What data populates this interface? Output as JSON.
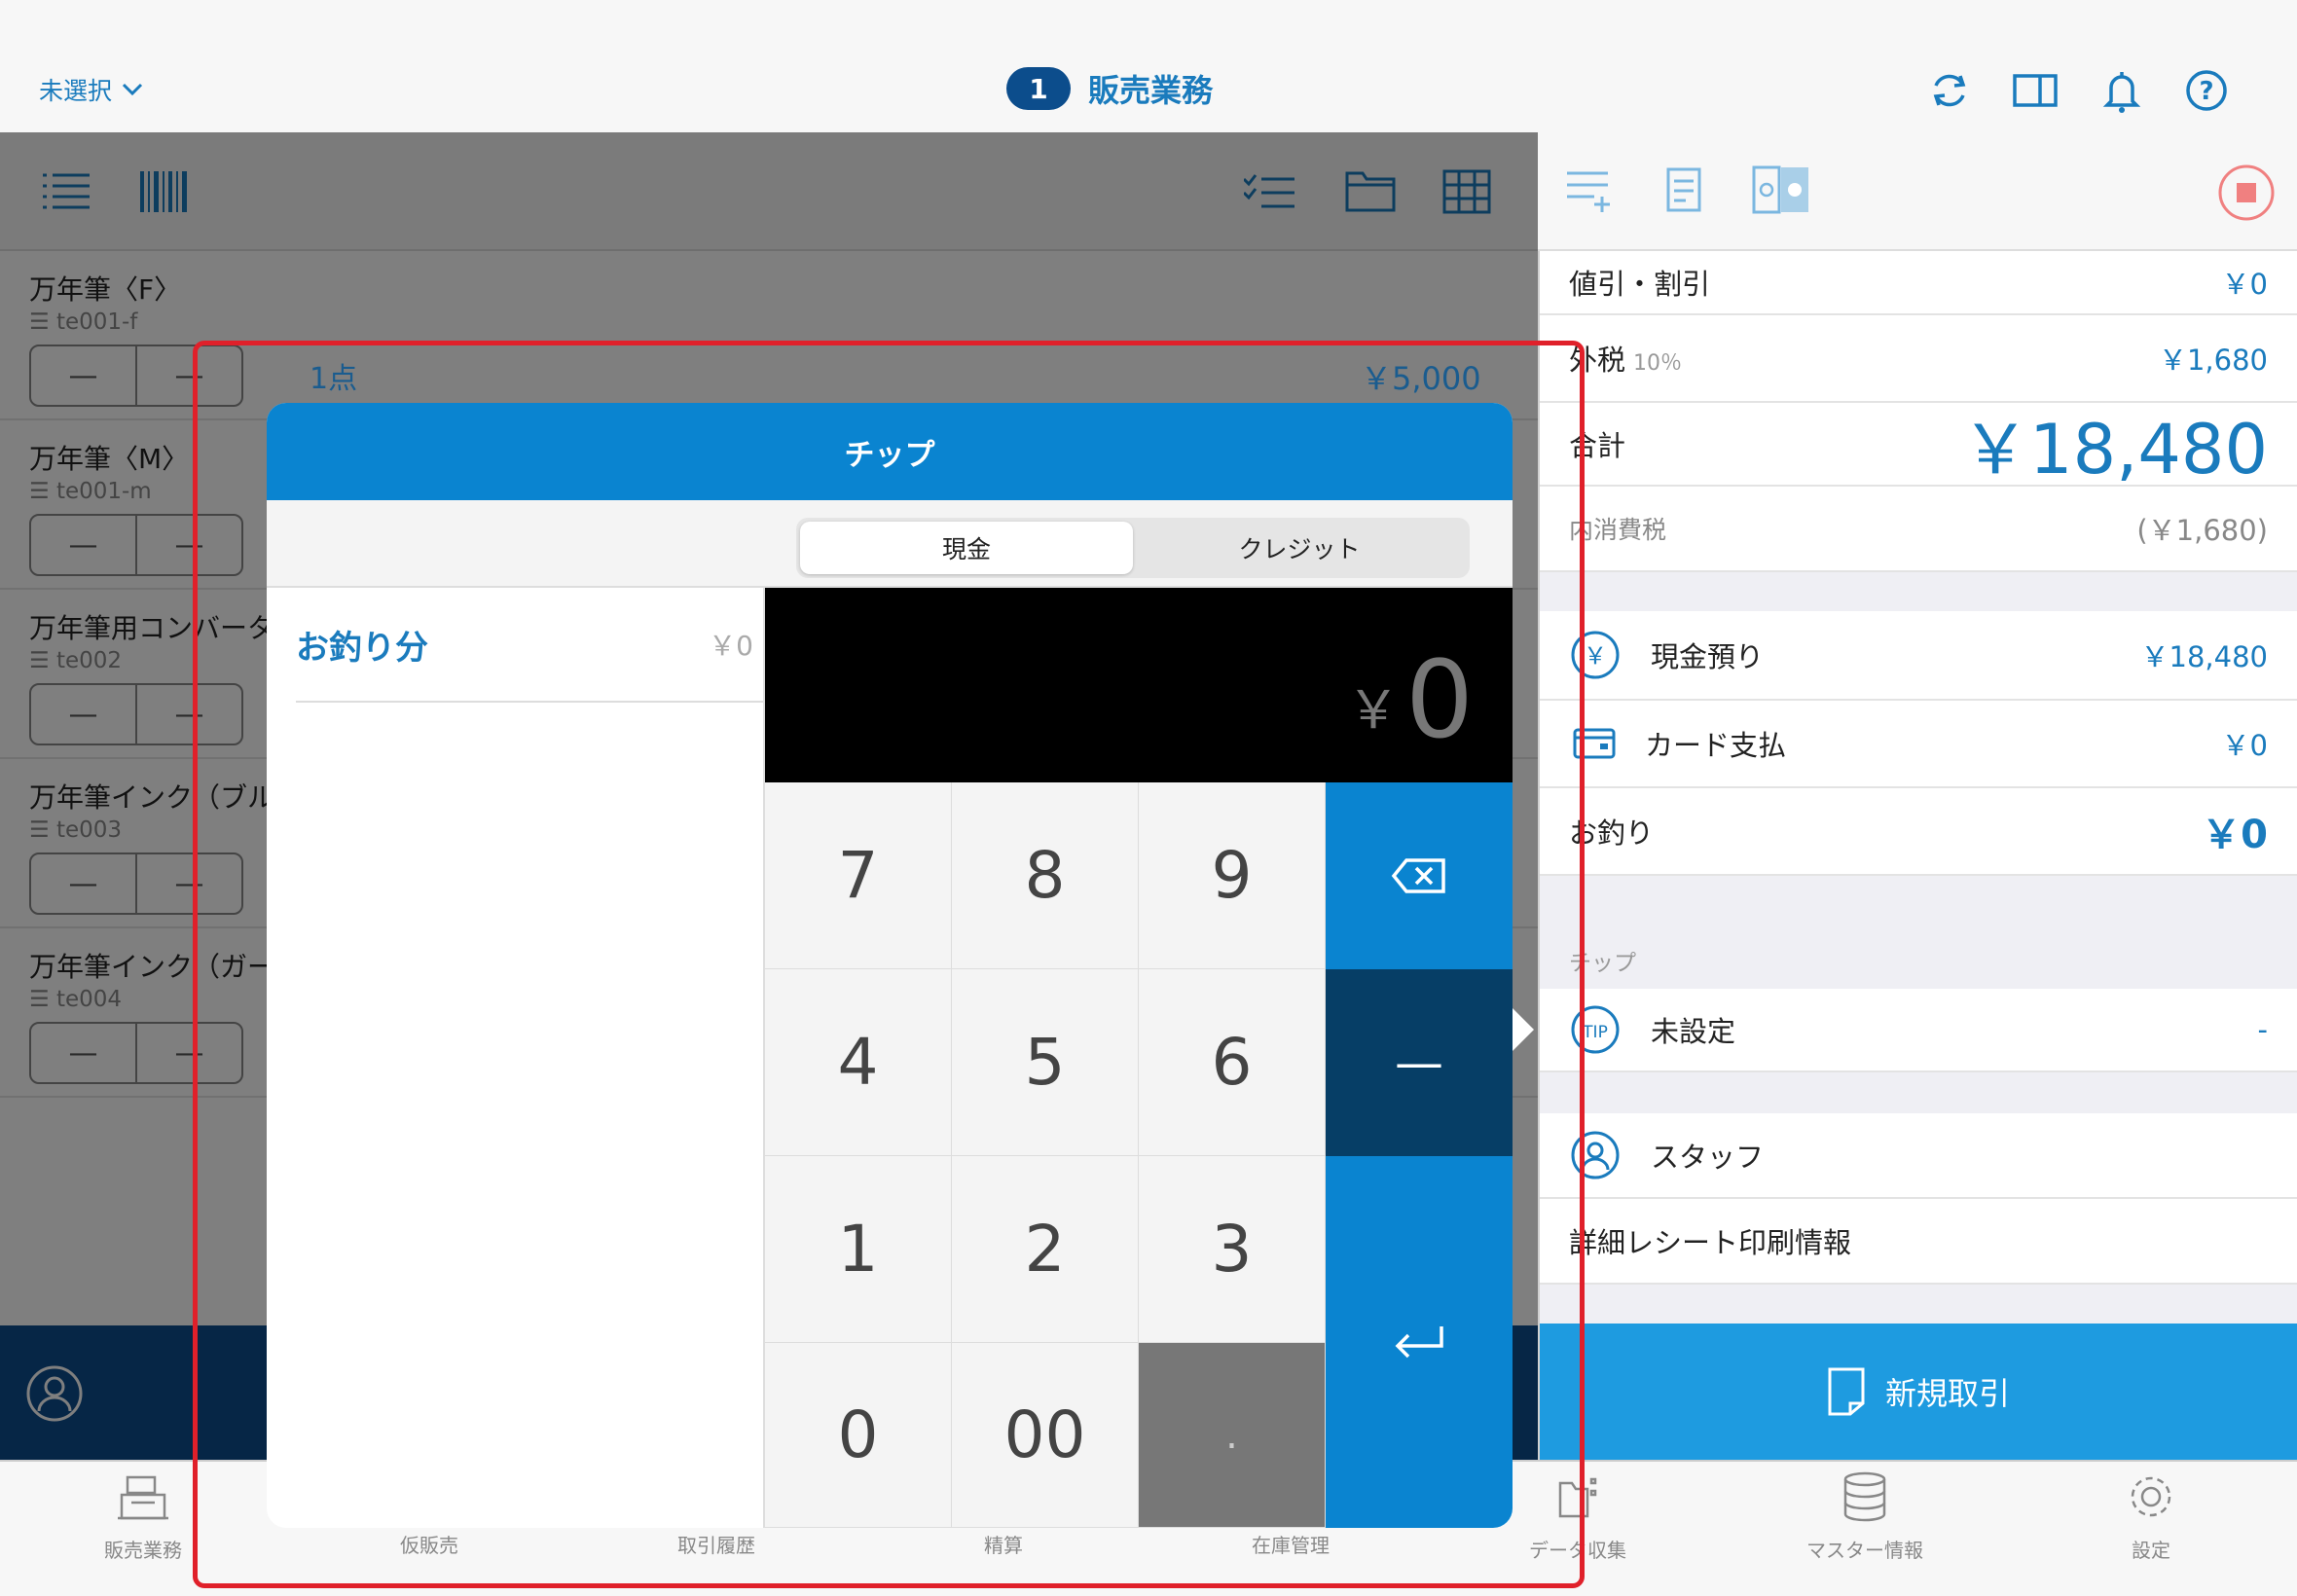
{
  "header": {
    "store_select": "未選択",
    "badge": "1",
    "title": "販売業務"
  },
  "products": [
    {
      "name": "万年筆〈F〉",
      "code": "te001-f"
    },
    {
      "name": "万年筆〈M〉",
      "code": "te001-m"
    },
    {
      "name": "万年筆用コンバータ",
      "code": "te002"
    },
    {
      "name": "万年筆インク（ブル",
      "code": "te003"
    },
    {
      "name": "万年筆インク（ガー",
      "code": "te004"
    }
  ],
  "stepper": {
    "minus": "—",
    "plus": "—"
  },
  "summary": {
    "count": "1点",
    "amount": "￥5,000"
  },
  "right": {
    "discount_label": "値引・割引",
    "discount_value": "￥0",
    "tax_label": "外税",
    "tax_rate": "10％",
    "tax_value": "￥1,680",
    "total_label": "合計",
    "total_value": "￥18,480",
    "inner_tax_label": "内消費税",
    "inner_tax_value": "(￥1,680)",
    "cash_label": "現金預り",
    "cash_value": "￥18,480",
    "card_label": "カード支払",
    "card_value": "￥0",
    "change_label": "お釣り",
    "change_value": "￥0",
    "tip_section": "チップ",
    "tip_label": "未設定",
    "tip_value": "-",
    "staff_label": "スタッフ",
    "receipt_label": "詳細レシート印刷情報",
    "new_deal": "新規取引"
  },
  "modal": {
    "title": "チップ",
    "seg_cash": "現金",
    "seg_credit": "クレジット",
    "change_label": "お釣り分",
    "change_value": "￥0",
    "display_yen": "￥",
    "display_value": "0",
    "keys": [
      "7",
      "8",
      "9",
      "4",
      "5",
      "6",
      "1",
      "2",
      "3",
      "0",
      "00",
      "."
    ],
    "minus_key": "—"
  },
  "tabs": [
    "販売業務",
    "仮販売",
    "取引履歴",
    "精算",
    "在庫管理",
    "データ収集",
    "マスター情報",
    "設定"
  ],
  "colors": {
    "primary": "#0a84d0",
    "dark": "#0c4d8c",
    "highlight": "#e0202a"
  }
}
